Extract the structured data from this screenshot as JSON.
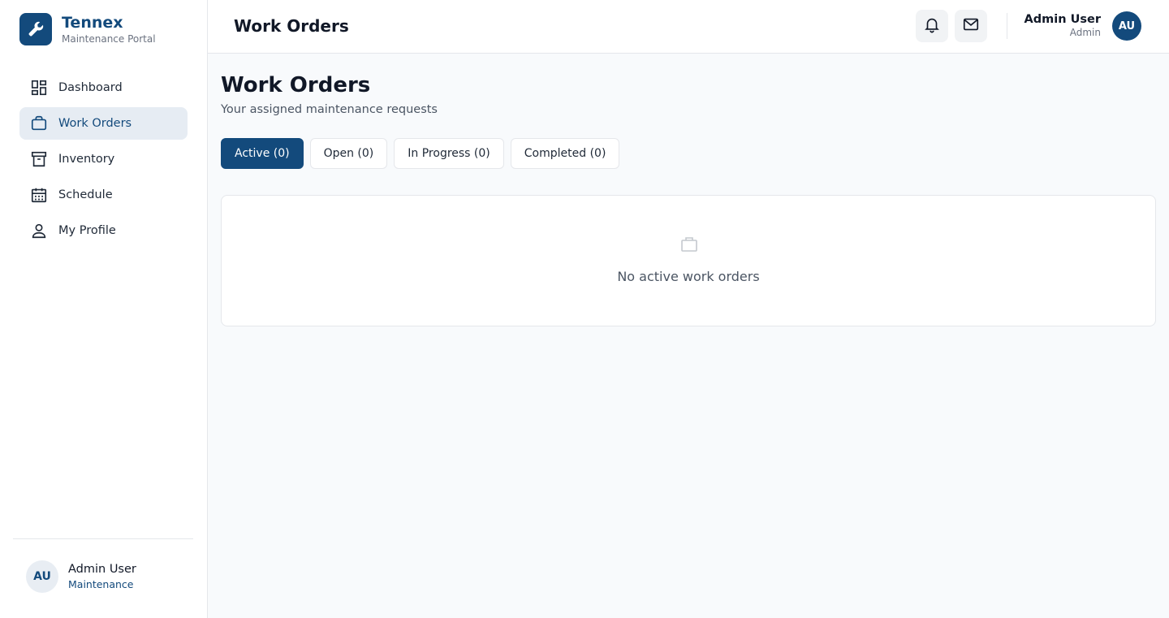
{
  "brand": {
    "name": "Tennex",
    "subtitle": "Maintenance Portal"
  },
  "nav": [
    {
      "label": "Dashboard",
      "icon": "dashboard-icon",
      "active": false
    },
    {
      "label": "Work Orders",
      "icon": "briefcase-icon",
      "active": true
    },
    {
      "label": "Inventory",
      "icon": "archive-box-icon",
      "active": false
    },
    {
      "label": "Schedule",
      "icon": "calendar-icon",
      "active": false
    },
    {
      "label": "My Profile",
      "icon": "user-icon",
      "active": false
    }
  ],
  "sidebar_user": {
    "initials": "AU",
    "name": "Admin User",
    "role": "Maintenance"
  },
  "topbar": {
    "title": "Work Orders",
    "user": {
      "initials": "AU",
      "name": "Admin User",
      "role": "Admin"
    }
  },
  "page": {
    "title": "Work Orders",
    "subtitle": "Your assigned maintenance requests",
    "tabs": [
      {
        "label": "Active (0)",
        "active": true
      },
      {
        "label": "Open (0)",
        "active": false
      },
      {
        "label": "In Progress (0)",
        "active": false
      },
      {
        "label": "Completed (0)",
        "active": false
      }
    ],
    "empty_message": "No active work orders"
  },
  "colors": {
    "brand": "#134a7c",
    "active_nav_bg": "#e6ecf3",
    "page_bg": "#f8fafc"
  }
}
